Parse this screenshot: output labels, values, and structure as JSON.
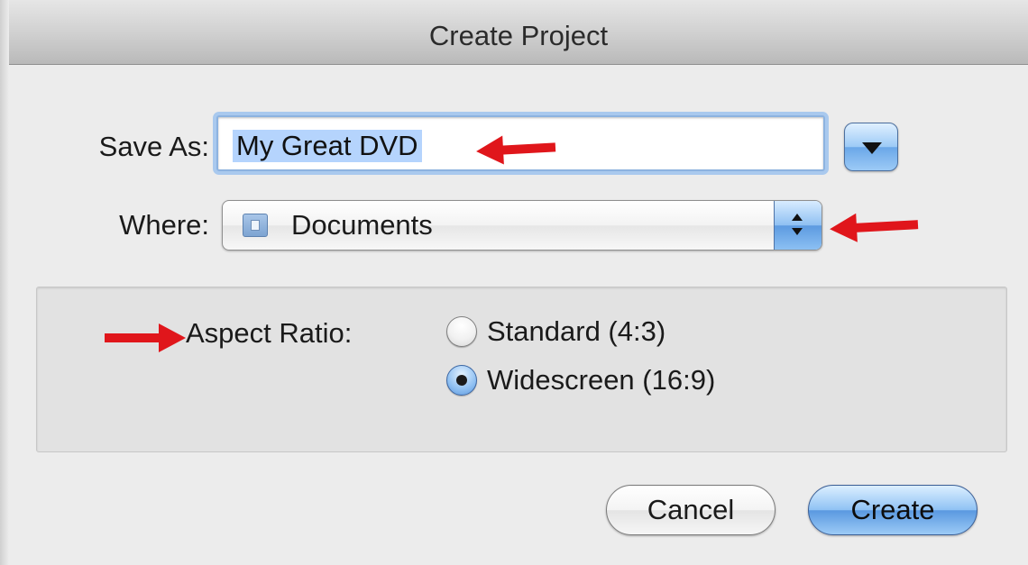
{
  "dialog": {
    "title": "Create Project"
  },
  "save_as": {
    "label": "Save As:",
    "value": "My Great DVD"
  },
  "where": {
    "label": "Where:",
    "selected": "Documents"
  },
  "aspect_ratio": {
    "label": "Aspect Ratio:",
    "options": [
      {
        "label": "Standard (4:3)",
        "checked": false
      },
      {
        "label": "Widescreen (16:9)",
        "checked": true
      }
    ]
  },
  "buttons": {
    "cancel": "Cancel",
    "create": "Create"
  },
  "colors": {
    "annotation_arrow": "#e0161b",
    "accent_blue": "#8fc2f4",
    "selection_highlight": "#b5d4fd"
  },
  "icons": {
    "expand": "chevron-down-icon",
    "folder": "folder-icon",
    "stepper": "up-down-stepper-icon",
    "annotation": "red-arrow-icon"
  }
}
